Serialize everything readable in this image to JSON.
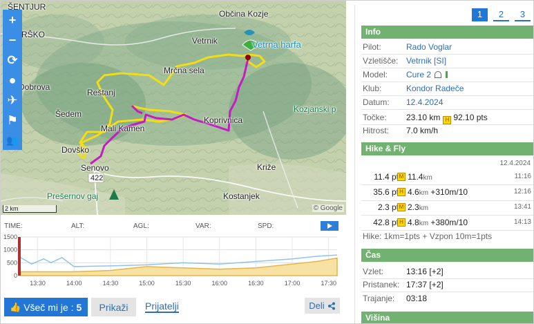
{
  "map": {
    "labels": {
      "sentjur": "ŠENTJUR",
      "rsko": "RŠKO",
      "obcina_kozje": "Občina Kozje",
      "vetrnik": "Vetrnik",
      "vetrna_harfa": "Vetrna harfa",
      "mrcna_sela": "Mrčna sela",
      "dobrova": "Dobrova",
      "restanj": "Reštanj",
      "sedem": "Šedem",
      "kozjanski": "Kozjanski p",
      "koprivnica": "Koprivnica",
      "mali_kamen": "Mali Kamen",
      "dovsko": "Dovško",
      "senovo": "Senovo",
      "road_422": "422",
      "krize": "Križe",
      "kostanjek": "Kostanjek",
      "presernov_gaj": "Prešernov gaj"
    },
    "scale": "2 km",
    "attribution": "© Google",
    "tools": [
      "zoom-in",
      "zoom-out",
      "rotate",
      "balloon",
      "plane",
      "windsock",
      "people"
    ],
    "tool_symbols": [
      "+",
      "−",
      "⟳",
      "●",
      "✈",
      "⚑",
      "👥"
    ]
  },
  "elevation": {
    "headers": {
      "time": "TIME:",
      "alt": "ALT:",
      "agl": "AGL:",
      "var": "VAR:",
      "spd": "SPD:"
    },
    "y_ticks": [
      "1500",
      "1000",
      "500",
      "0"
    ],
    "x_ticks": [
      "13:30",
      "14:00",
      "14:30",
      "15:00",
      "15:30",
      "16:00",
      "16:30",
      "17:00",
      "17:30"
    ]
  },
  "chart_data": {
    "type": "area",
    "ylim": [
      0,
      1500
    ],
    "x": [
      "13:16",
      "13:25",
      "13:35",
      "13:41",
      "13:50",
      "14:00",
      "14:30",
      "15:00",
      "15:30",
      "16:00",
      "16:30",
      "17:00",
      "17:20",
      "17:37"
    ],
    "series": [
      {
        "values": [
          700,
          450,
          650,
          500,
          700,
          350,
          380,
          420,
          500,
          450,
          550,
          650,
          750,
          800
        ]
      },
      {
        "values": [
          150,
          150,
          150,
          150,
          150,
          150,
          200,
          350,
          300,
          250,
          300,
          450,
          550,
          680
        ]
      }
    ]
  },
  "actions": {
    "like_label": "Všeč mi je : ",
    "like_count": "5",
    "show_label": "Prikaži",
    "friends_label": "Prijatelji",
    "share_label": "Deli"
  },
  "pager": [
    "1",
    "2",
    "3"
  ],
  "info": {
    "title": "Info",
    "rows": [
      {
        "key": "Pilot:",
        "value": "Rado Voglar"
      },
      {
        "key": "Vzletišče:",
        "value": "Vetrnik [SI]"
      },
      {
        "key": "Model:",
        "value": "Cure 2"
      },
      {
        "key": "Klub:",
        "value": "Kondor Radeče"
      },
      {
        "key": "Datum:",
        "value": "12.4.2024"
      },
      {
        "key": "Točke:",
        "value": "23.10 km",
        "value2": "92.10 pts"
      },
      {
        "key": "Hitrost:",
        "value": "7.0 km/h"
      }
    ]
  },
  "hike": {
    "title": "Hike & Fly",
    "date": "12.4.2024",
    "rows": [
      {
        "pts": "11.4 pts",
        "icon": "M",
        "dist": "11.4",
        "unit": "km",
        "extra": "",
        "time": "11:16"
      },
      {
        "pts": "35.6 pts",
        "icon": "H",
        "dist": "4.6",
        "unit": "km",
        "extra": "+310m/10",
        "time": "12:16"
      },
      {
        "pts": "2.3 pts",
        "icon": "M",
        "dist": "2.3",
        "unit": "km",
        "extra": "",
        "time": "13:41"
      },
      {
        "pts": "42.8 pts",
        "icon": "H",
        "dist": "4.8",
        "unit": "km",
        "extra": "+380m/10",
        "time": "14:13"
      }
    ],
    "note": "Hike: 1km=1pts + Vzpon 10m=1pts"
  },
  "cas": {
    "title": "Čas",
    "rows": [
      {
        "key": "Vzlet:",
        "value": "13:16 [+2]"
      },
      {
        "key": "Pristanek:",
        "value": "17:37 [+2]"
      },
      {
        "key": "Trajanje:",
        "value": "03:18"
      }
    ]
  },
  "visina": {
    "title": "Višina"
  }
}
